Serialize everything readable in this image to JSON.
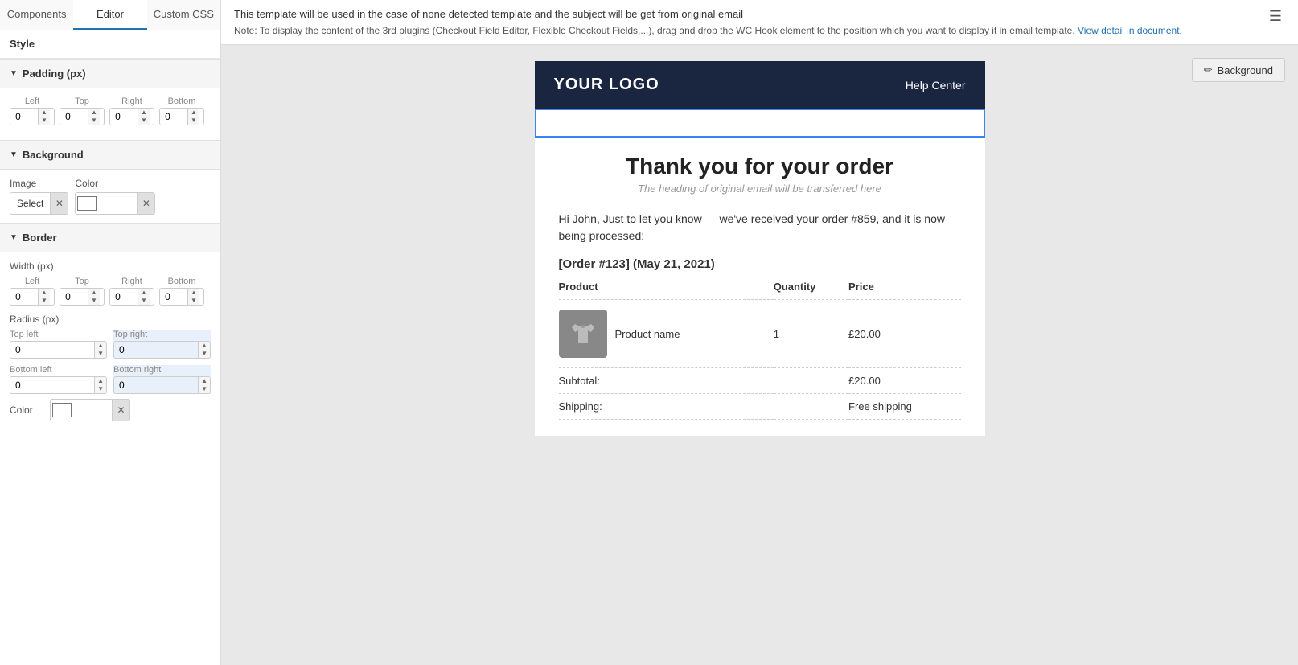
{
  "tabs": [
    {
      "id": "components",
      "label": "Components"
    },
    {
      "id": "editor",
      "label": "Editor",
      "active": true
    },
    {
      "id": "custom-css",
      "label": "Custom CSS"
    }
  ],
  "style_label": "Style",
  "padding": {
    "section_label": "Padding (px)",
    "left_label": "Left",
    "top_label": "Top",
    "right_label": "Right",
    "bottom_label": "Bottom",
    "left_value": "0",
    "top_value": "0",
    "right_value": "0",
    "bottom_value": "0"
  },
  "background": {
    "section_label": "Background",
    "image_label": "Image",
    "color_label": "Color",
    "select_label": "Select"
  },
  "border": {
    "section_label": "Border",
    "width_label": "Width (px)",
    "left_label": "Left",
    "top_label": "Top",
    "right_label": "Right",
    "bottom_label": "Bottom",
    "left_value": "0",
    "top_value": "0",
    "right_value": "0",
    "bottom_value": "0",
    "radius_label": "Radius (px)",
    "top_left_label": "Top left",
    "top_right_label": "Top right",
    "bottom_left_label": "Bottom left",
    "bottom_right_label": "Bottom right",
    "top_left_value": "0",
    "top_right_value": "0",
    "bottom_left_value": "0",
    "bottom_right_value": "0",
    "color_label": "Color"
  },
  "info_bar": {
    "message": "This template will be used in the case of none detected template and the subject will be get from original email",
    "note_prefix": "Note: To display the content of the 3rd plugins (Checkout Field Editor, Flexible Checkout Fields,...), drag and drop the WC Hook element to the position which you want to display it in email template.",
    "note_link_text": "View detail in document."
  },
  "background_button": {
    "label": "Background",
    "icon": "✏"
  },
  "email_preview": {
    "logo": "YOUR LOGO",
    "help_center": "Help Center",
    "heading": "Thank you for your order",
    "subheading": "The heading of original email will be transferred here",
    "greeting": "Hi John, Just to let you know — we've received your order #859, and it is now being processed:",
    "order_title": "[Order #123] (May 21, 2021)",
    "columns": [
      {
        "label": "Product"
      },
      {
        "label": "Quantity"
      },
      {
        "label": "Price"
      }
    ],
    "products": [
      {
        "name": "Product name",
        "quantity": "1",
        "price": "£20.00"
      }
    ],
    "subtotal_label": "Subtotal:",
    "subtotal_value": "£20.00",
    "shipping_label": "Shipping:",
    "shipping_value": "Free shipping"
  }
}
